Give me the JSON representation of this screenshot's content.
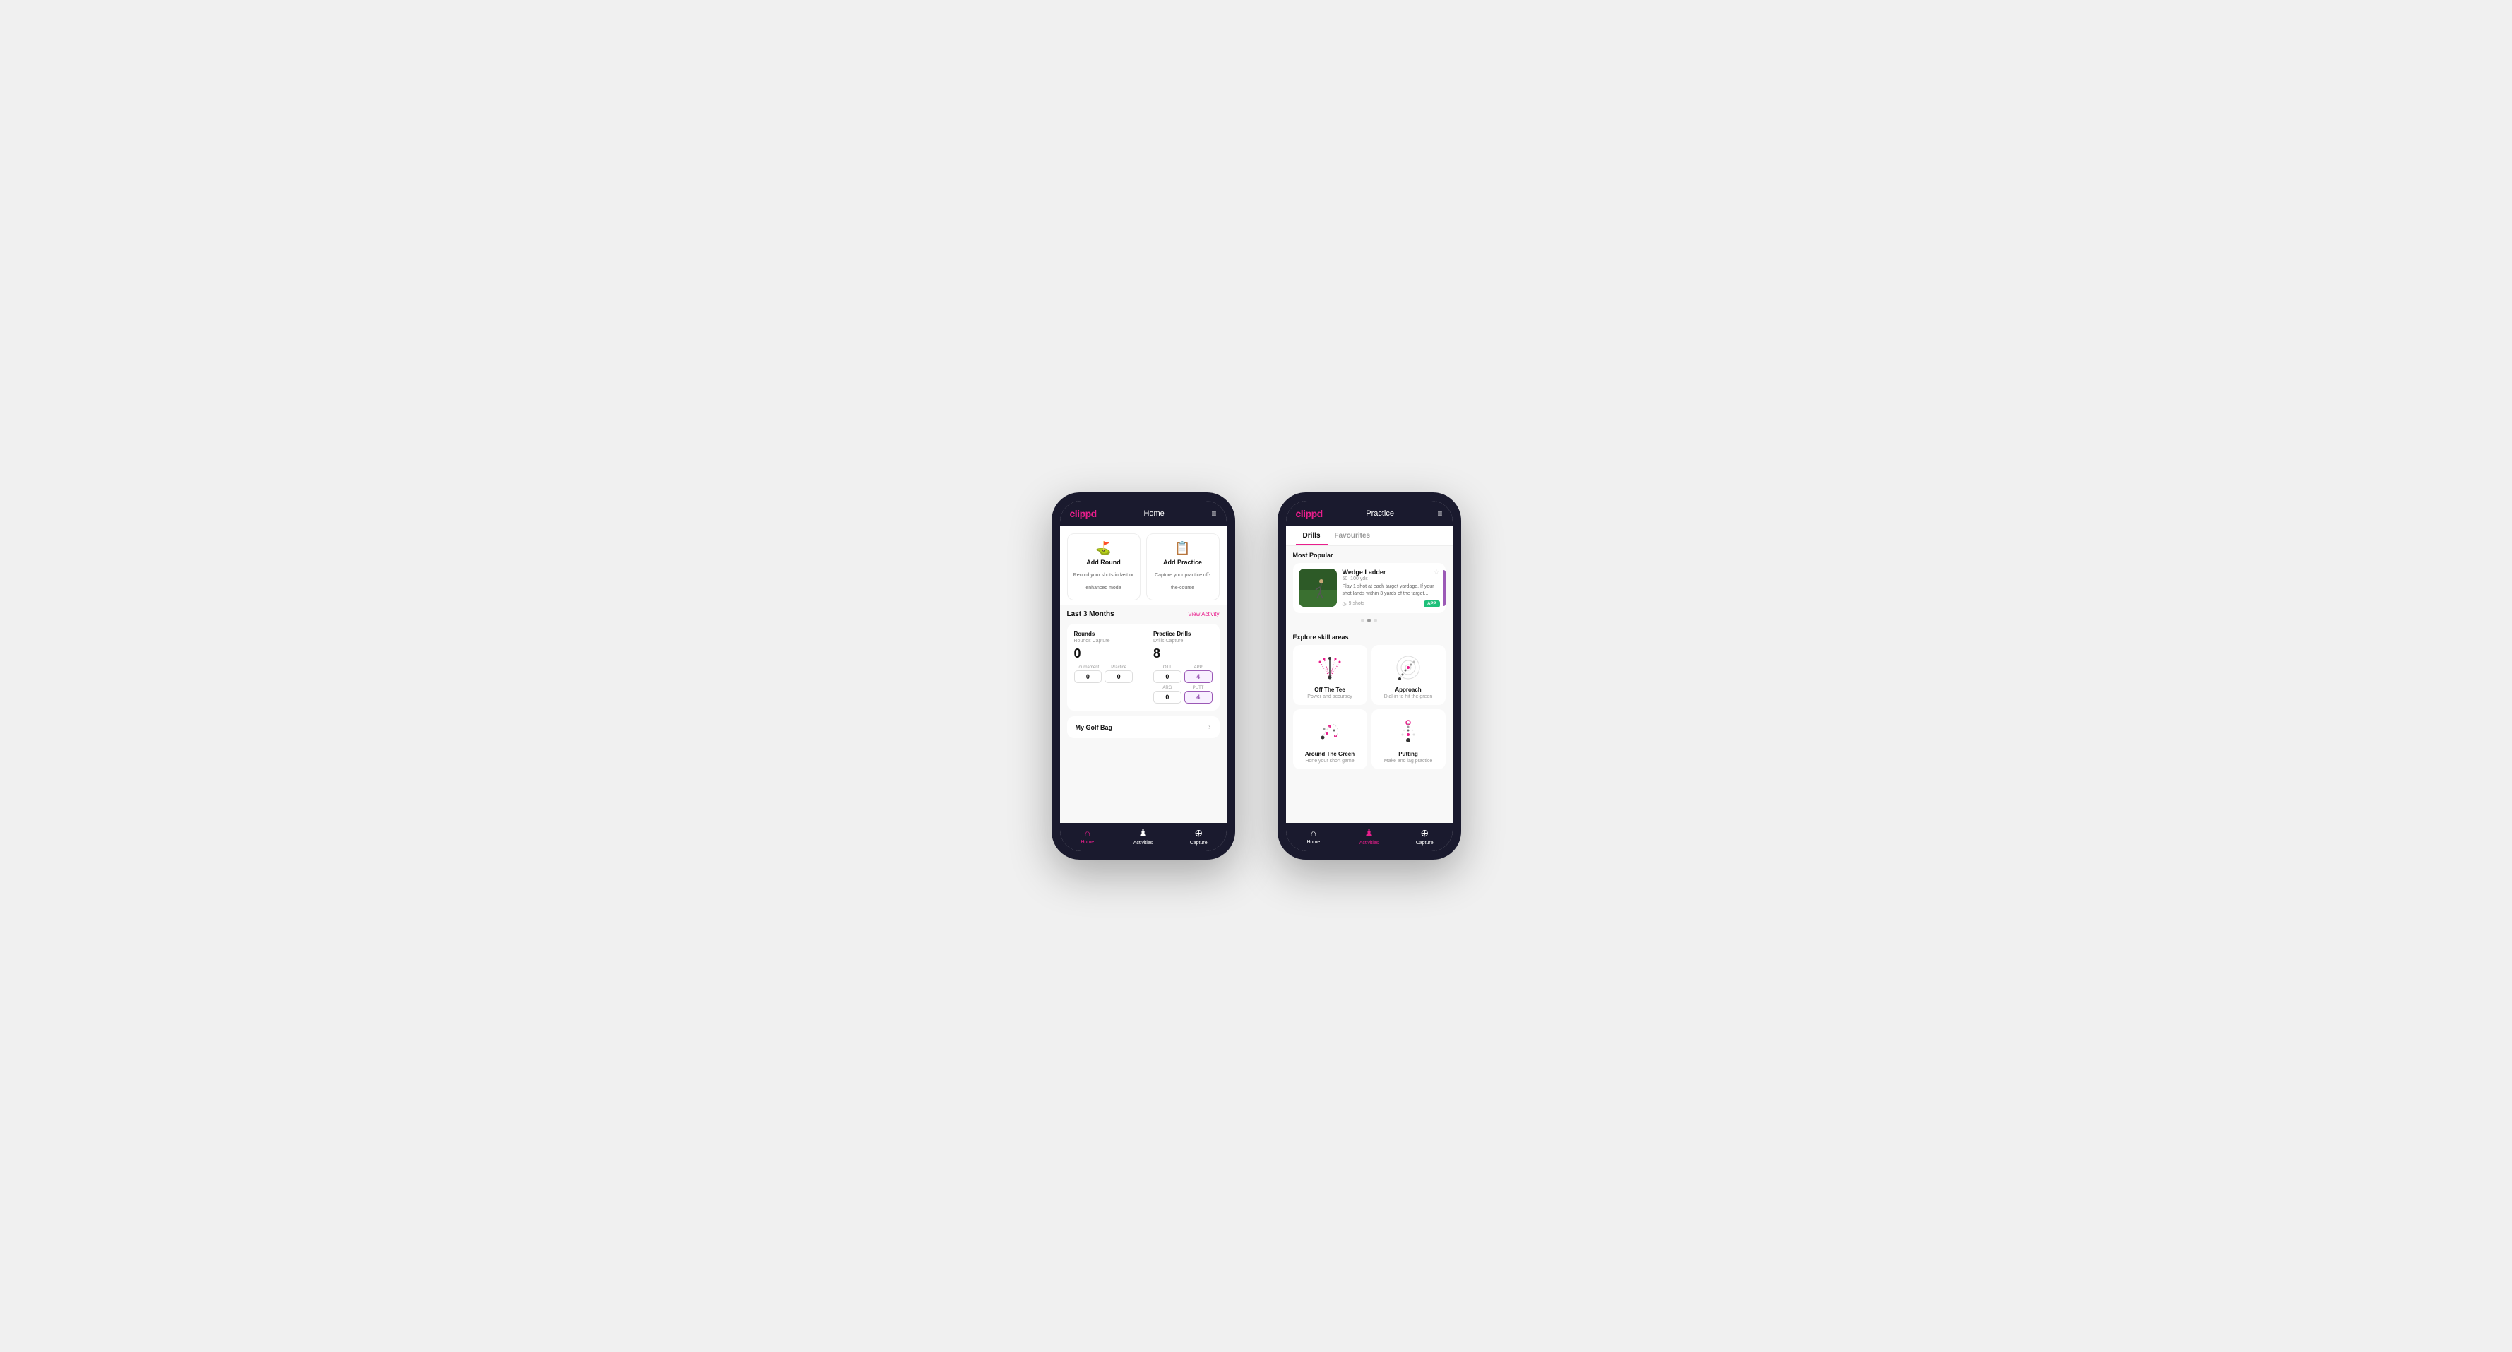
{
  "phone1": {
    "header": {
      "logo": "clippd",
      "title": "Home",
      "menu_icon": "≡"
    },
    "quick_actions": [
      {
        "id": "add-round",
        "icon": "⛳",
        "title": "Add Round",
        "subtitle": "Record your shots in fast or enhanced mode"
      },
      {
        "id": "add-practice",
        "icon": "📋",
        "title": "Add Practice",
        "subtitle": "Capture your practice off-the-course"
      }
    ],
    "activity_section": {
      "title": "Last 3 Months",
      "link": "View Activity"
    },
    "rounds": {
      "title": "Rounds",
      "subtitle": "Rounds Capture",
      "total": "0",
      "items": [
        {
          "label": "Tournament",
          "value": "0"
        },
        {
          "label": "Practice",
          "value": "0"
        }
      ]
    },
    "practice_drills": {
      "title": "Practice Drills",
      "subtitle": "Drills Capture",
      "total": "8",
      "items": [
        {
          "label": "OTT",
          "value": "0"
        },
        {
          "label": "APP",
          "value": "4",
          "highlight": true
        },
        {
          "label": "ARG",
          "value": "0"
        },
        {
          "label": "PUTT",
          "value": "4",
          "highlight": true
        }
      ]
    },
    "golf_bag": {
      "label": "My Golf Bag"
    },
    "nav": [
      {
        "icon": "🏠",
        "label": "Home",
        "active": true
      },
      {
        "icon": "🏌️",
        "label": "Activities",
        "active": false
      },
      {
        "icon": "⊕",
        "label": "Capture",
        "active": false
      }
    ]
  },
  "phone2": {
    "header": {
      "logo": "clippd",
      "title": "Practice",
      "menu_icon": "≡"
    },
    "tabs": [
      {
        "label": "Drills",
        "active": true
      },
      {
        "label": "Favourites",
        "active": false
      }
    ],
    "most_popular": {
      "title": "Most Popular",
      "drill": {
        "name": "Wedge Ladder",
        "yardage": "50–100 yds",
        "description": "Play 1 shot at each target yardage. If your shot lands within 3 yards of the target...",
        "shots": "9 shots",
        "badge": "APP"
      }
    },
    "dots": [
      0,
      1,
      2
    ],
    "active_dot": 1,
    "skill_areas": {
      "title": "Explore skill areas",
      "items": [
        {
          "id": "off-the-tee",
          "name": "Off The Tee",
          "desc": "Power and accuracy",
          "icon_type": "tee"
        },
        {
          "id": "approach",
          "name": "Approach",
          "desc": "Dial-in to hit the green",
          "icon_type": "approach"
        },
        {
          "id": "around-the-green",
          "name": "Around The Green",
          "desc": "Hone your short game",
          "icon_type": "around"
        },
        {
          "id": "putting",
          "name": "Putting",
          "desc": "Make and lag practice",
          "icon_type": "putting"
        }
      ]
    },
    "nav": [
      {
        "icon": "🏠",
        "label": "Home",
        "active": false
      },
      {
        "icon": "🏌️",
        "label": "Activities",
        "active": true
      },
      {
        "icon": "⊕",
        "label": "Capture",
        "active": false
      }
    ]
  }
}
